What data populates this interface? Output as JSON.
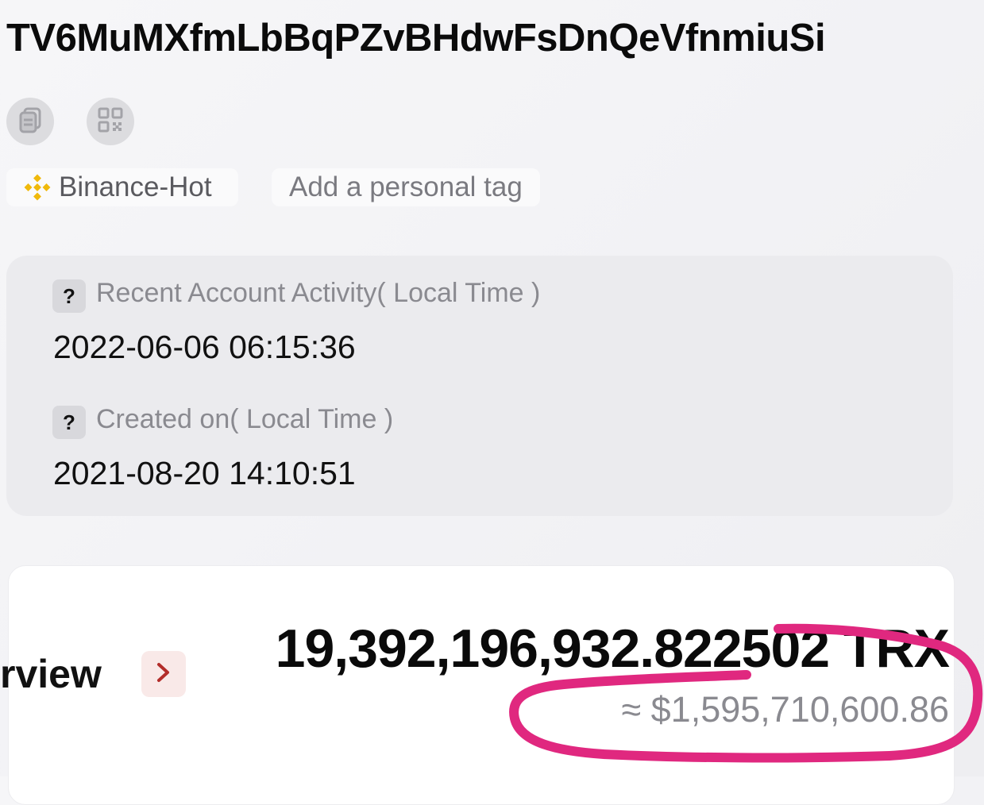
{
  "account": {
    "address": "TV6MuMXfmLbBqPZvBHdwFsDnQeVfnmiuSi"
  },
  "actions": {
    "copy_icon": "copy-icon",
    "qr_icon": "qr-code-icon"
  },
  "tags": {
    "exchange_label": "Binance-Hot",
    "personal_tag_label": "Add a personal tag"
  },
  "activity": {
    "help_glyph": "?",
    "recent_label": "Recent Account Activity( Local Time )",
    "recent_value": "2022-06-06 06:15:36",
    "created_label": "Created on( Local Time )",
    "created_value": "2021-08-20 14:10:51"
  },
  "overview": {
    "label": "rview",
    "balance_trx": "19,392,196,932.822502 TRX",
    "balance_usd": "≈ $1,595,710,600.86"
  },
  "colors": {
    "binance_yellow": "#f0b90b",
    "accent_red": "#b32d2a",
    "annotation_pink": "#e0287f"
  }
}
